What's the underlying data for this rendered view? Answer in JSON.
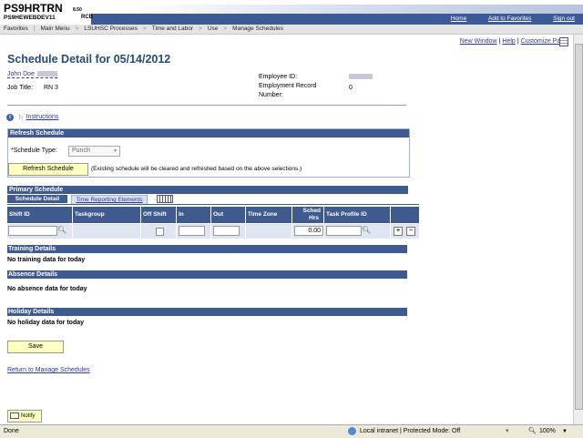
{
  "header": {
    "system_title": "PS9HRTRN",
    "version": "8.50",
    "database": "PS9HEWEBDEV11",
    "user": "RCB",
    "links": [
      "Home",
      "Add to Favorites",
      "Sign out"
    ]
  },
  "breadcrumb": [
    "Favorites",
    "Main Menu",
    "LSUHSC Processes",
    "Time and Labor",
    "Use",
    "Manage Schedules"
  ],
  "toplinks": {
    "new_window": "New Window",
    "help": "Help",
    "customize": "Customize Page"
  },
  "page_title": "Schedule Detail for 05/14/2012",
  "employee": {
    "name": "John Doe",
    "job_title_label": "Job Title:",
    "job_title": "RN 3",
    "employee_id_label": "Employee ID:",
    "emp_record_label": "Employment Record",
    "emp_record_label2": "Number:",
    "emp_record": "0"
  },
  "instructions": "Instructions",
  "refresh": {
    "heading": "Refresh Schedule",
    "schedule_type_label": "*Schedule Type:",
    "schedule_type_value": "Punch",
    "button": "Refresh Schedule",
    "note": "(Existing schedule will be cleared and refreshed based on the above selections.)"
  },
  "primary": {
    "heading": "Primary Schedule",
    "tabs": [
      "Schedule Detail",
      "Time Reporting Elements"
    ],
    "columns": [
      "Shift ID",
      "Taskgroup",
      "Off Shift",
      "In",
      "Out",
      "Time Zone",
      "Sched Hrs",
      "Task Profile ID"
    ],
    "sched_hrs_line1": "Sched",
    "sched_hrs_line2": "Hrs",
    "sched_hrs_value": "0.00"
  },
  "training": {
    "heading": "Training Details",
    "empty": "No training data for today"
  },
  "absence": {
    "heading": "Absence Details",
    "empty": "No absence data for today"
  },
  "holiday": {
    "heading": "Holiday Details",
    "empty": "No holiday data for today"
  },
  "save_button": "Save",
  "return_link": "Return to Manage Schedules",
  "notify_button": "Notify",
  "status": {
    "left": "Done",
    "zone": "Local intranet | Protected Mode: Off",
    "zoom": "100%"
  }
}
